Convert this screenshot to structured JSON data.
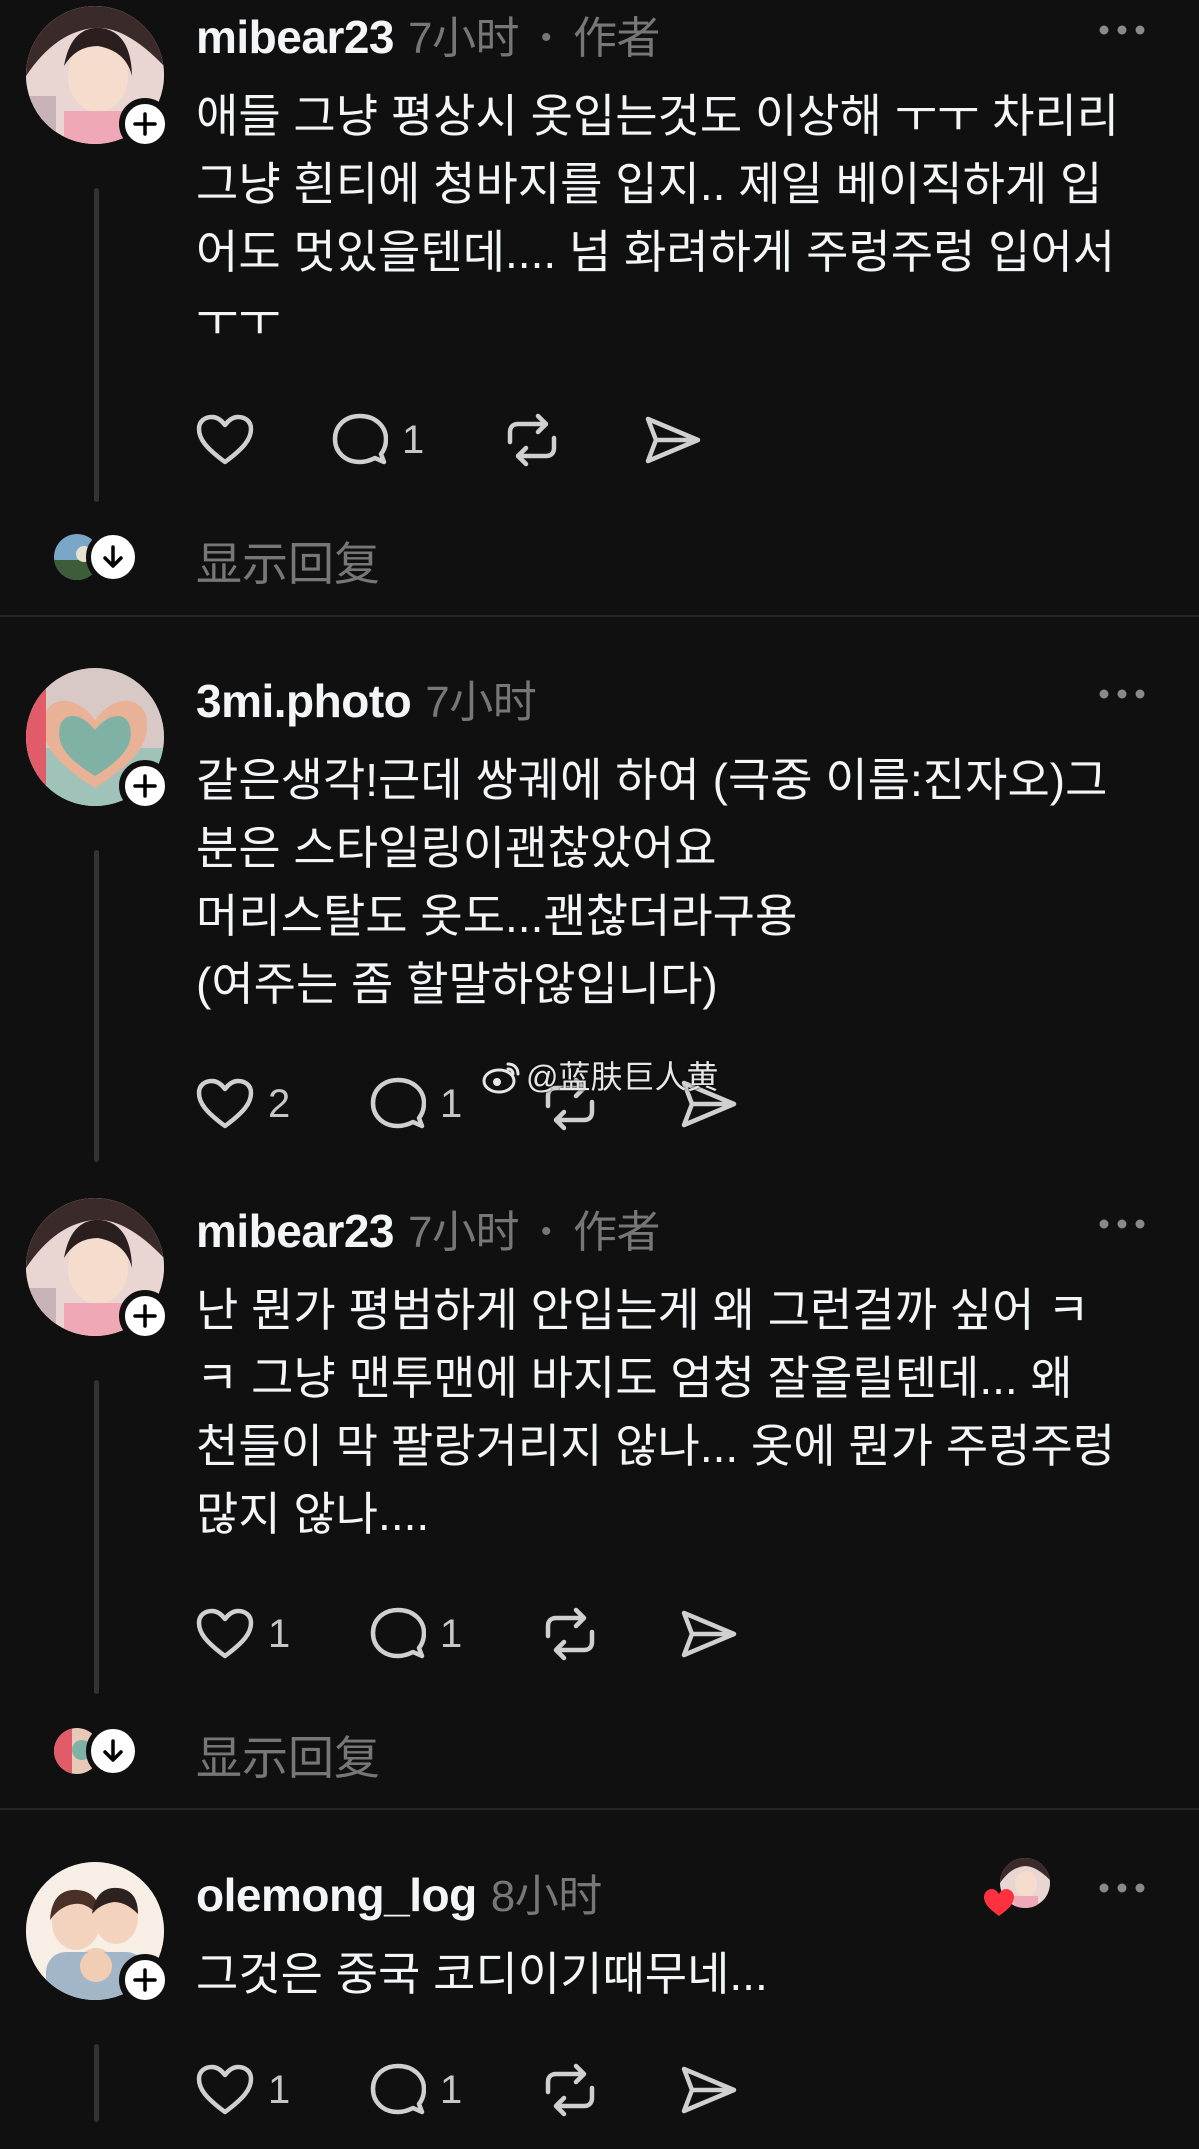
{
  "posts": [
    {
      "username": "mibear23",
      "time": "7小时",
      "author_badge": "作者",
      "text": "애들 그냥 평상시 옷입는것도 이상해 ㅜㅜ 차리리\n그냥 흰티에 청바지를 입지.. 제일 베이직하게 입\n어도 멋있을텐데.... 넘 화려하게 주렁주렁 입어서\nㅜㅜ",
      "likes": "",
      "replies": "1",
      "show_replies": "显示回复"
    },
    {
      "username": "3mi.photo",
      "time": "7小时",
      "text": "같은생각!근데 쌍궤에 하여 (극중 이름:진자오)그\n분은 스타일링이괜찮았어요\n머리스탈도 옷도...괜찮더라구용\n(여주는 좀 할말하않입니다)",
      "likes": "2",
      "replies": "1"
    },
    {
      "username": "mibear23",
      "time": "7小时",
      "author_badge": "作者",
      "text": "난 뭔가 평범하게 안입는게 왜 그런걸까 싶어 ㅋ\nㅋ 그냥 맨투맨에 바지도 엄청 잘올릴텐데... 왜\n천들이 막 팔랑거리지 않나... 옷에 뭔가 주렁주렁\n많지 않나....",
      "likes": "1",
      "replies": "1",
      "show_replies": "显示回复"
    },
    {
      "username": "olemong_log",
      "time": "8小时",
      "text": "그것은 중국 코디이기때무네...",
      "likes": "1",
      "replies": "1"
    }
  ],
  "watermark": "@蓝肤巨人黄",
  "colors": {
    "background": "#101010",
    "text": "#f3f5f7",
    "muted": "#777777",
    "like_heart": "#ff3040"
  }
}
